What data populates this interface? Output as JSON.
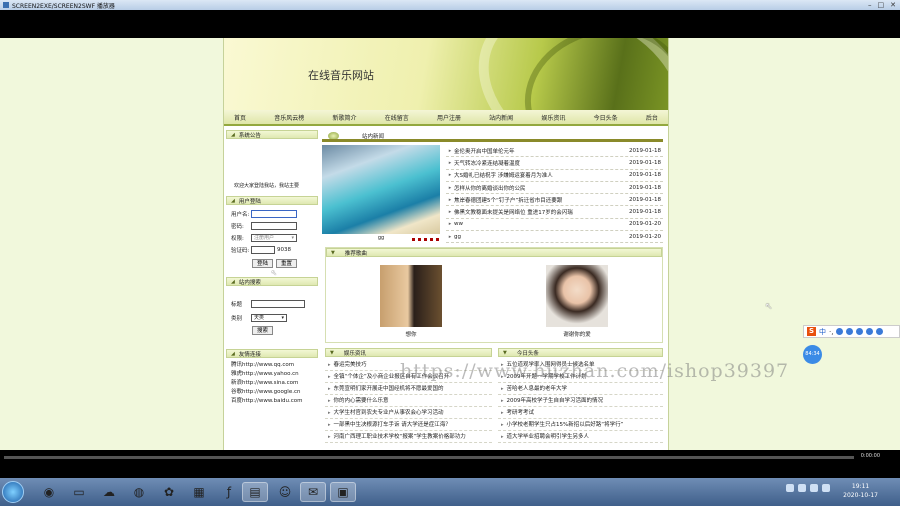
{
  "window": {
    "title": "SCREEN2EXE/SCREEN2SWF 播放器"
  },
  "site": {
    "title": "在线音乐网站"
  },
  "nav": [
    "首页",
    "音乐风云榜",
    "新歌简介",
    "在线留言",
    "用户注册",
    "站内新闻",
    "娱乐资讯",
    "今日头条",
    "后台"
  ],
  "announcement": {
    "title": "系统公告",
    "text": "欢迎大家登陆我站，我站主要"
  },
  "login": {
    "title": "用户登陆",
    "username_label": "用户名:",
    "password_label": "密码:",
    "role_label": "权限:",
    "role_value": "注册用户",
    "captcha_label": "验证码:",
    "captcha_code": "9038",
    "login_btn": "登陆",
    "reset_btn": "重置"
  },
  "site_search": {
    "title": "站内搜索",
    "title_label": "标题",
    "category_label": "类别",
    "category_value": "天类",
    "search_btn": "搜索"
  },
  "friend_links": {
    "title": "友情连接",
    "items": [
      "腾讯http://www.qq.com",
      "雅虎http://www.yahoo.cn",
      "新浪http://www.sina.com",
      "谷歌http://www.google.cn",
      "百度http://www.baidu.com"
    ]
  },
  "site_news": {
    "title": "站内新闻",
    "photo_caption": "gg",
    "items": [
      {
        "title": "金伦奥开启中国单伦元年",
        "date": "2019-01-18"
      },
      {
        "title": "天气转冻冷紧连结凝着温度",
        "date": "2019-01-18"
      },
      {
        "title": "大S婚礼已结祝字 涉嫌姆运宴着月为准人",
        "date": "2019-01-18"
      },
      {
        "title": "怎样从你的离婚谈出你的公民",
        "date": "2019-01-18"
      },
      {
        "title": "焦岸春德团建5个“钉子户”拆迁省市目还要跟",
        "date": "2019-01-18"
      },
      {
        "title": "佛黑文教稳面未提关是网络位 重进17岁的会闪瑞",
        "date": "2019-01-18"
      },
      {
        "title": "ww",
        "date": "2019-01-20"
      },
      {
        "title": "gg",
        "date": "2019-01-20"
      }
    ]
  },
  "recommended": {
    "title": "推荐歌曲",
    "songs": [
      {
        "caption": "想你"
      },
      {
        "caption": "谢谢你的爱"
      }
    ]
  },
  "entertainment": {
    "title": "娱乐资讯",
    "items": [
      "春运完美技巧",
      "全镇“个体企”及小商企业报区自有工作会议召开",
      "东莞宣明们家开展走中国经机将不愿最爱国的",
      "你的内心需要什么乐意",
      "大学生村官到农夫专业户从事农会心学习活动",
      "一部黑中生决根源打车手诉 请大学还是症江海？",
      "河南广西理工职业技术学校“报案”学生教案价格部功力"
    ]
  },
  "headlines": {
    "title": "今日头条",
    "items": [
      "五位道观学率入围网得员士候选名单",
      "2009年开题一学期学校工作计划",
      "苦哈老人息最的老年大学",
      "2009年高校学子生自自学习活面的情况",
      "考研考考试",
      "小学校老期学生只占15%新招以后好路“将学行”",
      "道大学毕业招聘会明引学生另多人"
    ]
  },
  "watermark": "https://www.huzhan.com/ishop39397",
  "ime": {
    "logo": "S",
    "mode": "中"
  },
  "bubble": "84:34",
  "clock": {
    "time": "19:11",
    "date": "2020-10-17"
  },
  "player": {
    "time": "0:00:00"
  }
}
